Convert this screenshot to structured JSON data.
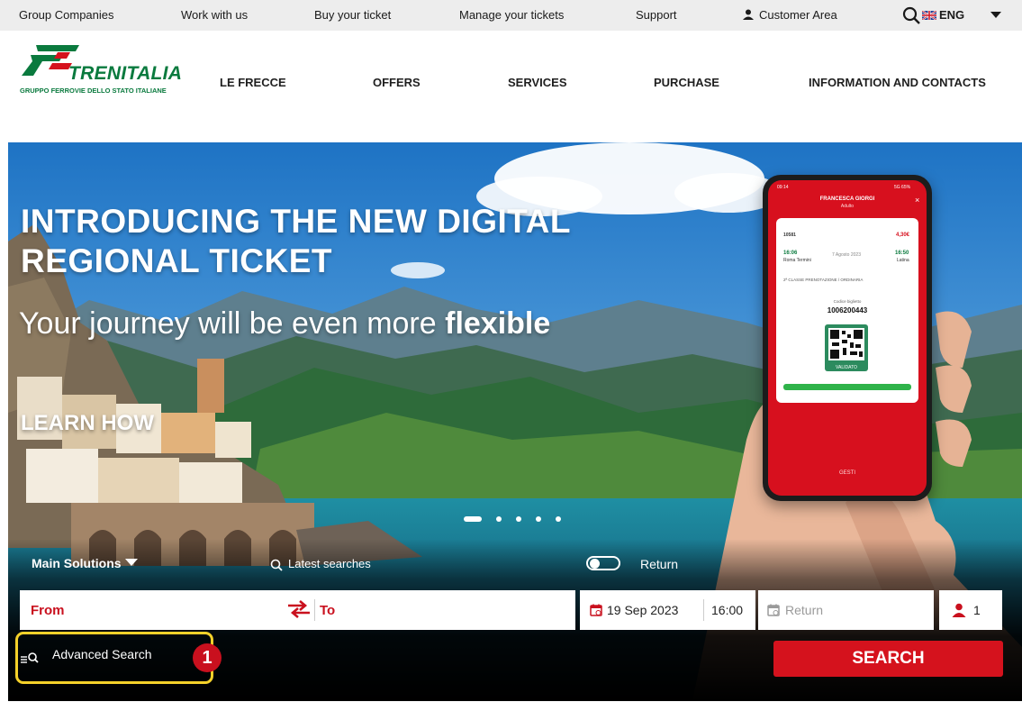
{
  "topbar": {
    "links": [
      "Group Companies",
      "Work with us",
      "Buy your ticket",
      "Manage your tickets",
      "Support"
    ],
    "customer_area": "Customer Area",
    "language": "ENG"
  },
  "header": {
    "brand": "TRENITALIA",
    "brand_sub": "GRUPPO FERROVIE DELLO STATO ITALIANE",
    "nav": [
      "LE FRECCE",
      "OFFERS",
      "SERVICES",
      "PURCHASE",
      "INFORMATION AND CONTACTS"
    ]
  },
  "hero": {
    "headline_line1": "INTRODUCING THE NEW DIGITAL",
    "headline_line2": "REGIONAL TICKET",
    "subline_regular": "Your journey will be even more ",
    "subline_bold": "flexible",
    "cta": "LEARN HOW",
    "slides": 5,
    "active_slide": 1
  },
  "phone": {
    "time": "09:14",
    "battery": "5G 65%",
    "passenger": "FRANCESCA GIORGI",
    "passenger_type": "Adulto",
    "train": "10581",
    "price": "4,30€",
    "dep_time": "16:06",
    "dep_station": "Roma Termini",
    "date": "7 Agosto 2023",
    "arr_time": "16:50",
    "arr_station": "Latina",
    "class": "2ª CLASSE PRENOTAZIONE / ORDINARIA",
    "code_label": "Codice biglietto",
    "code": "1006200443",
    "status": "VALIDATO",
    "footer": "GESTI"
  },
  "search": {
    "solutions_label": "Main Solutions",
    "latest_label": "Latest searches",
    "return_label": "Return",
    "from_label": "From",
    "to_label": "To",
    "date": "19 Sep 2023",
    "time": "16:00",
    "return_placeholder": "Return",
    "passengers": "1",
    "advanced_label": "Advanced Search",
    "search_button": "SEARCH",
    "annotation": "1"
  },
  "colors": {
    "brand_red": "#d5121d",
    "brand_green": "#0a7a3e",
    "highlight": "#f4d12a"
  }
}
